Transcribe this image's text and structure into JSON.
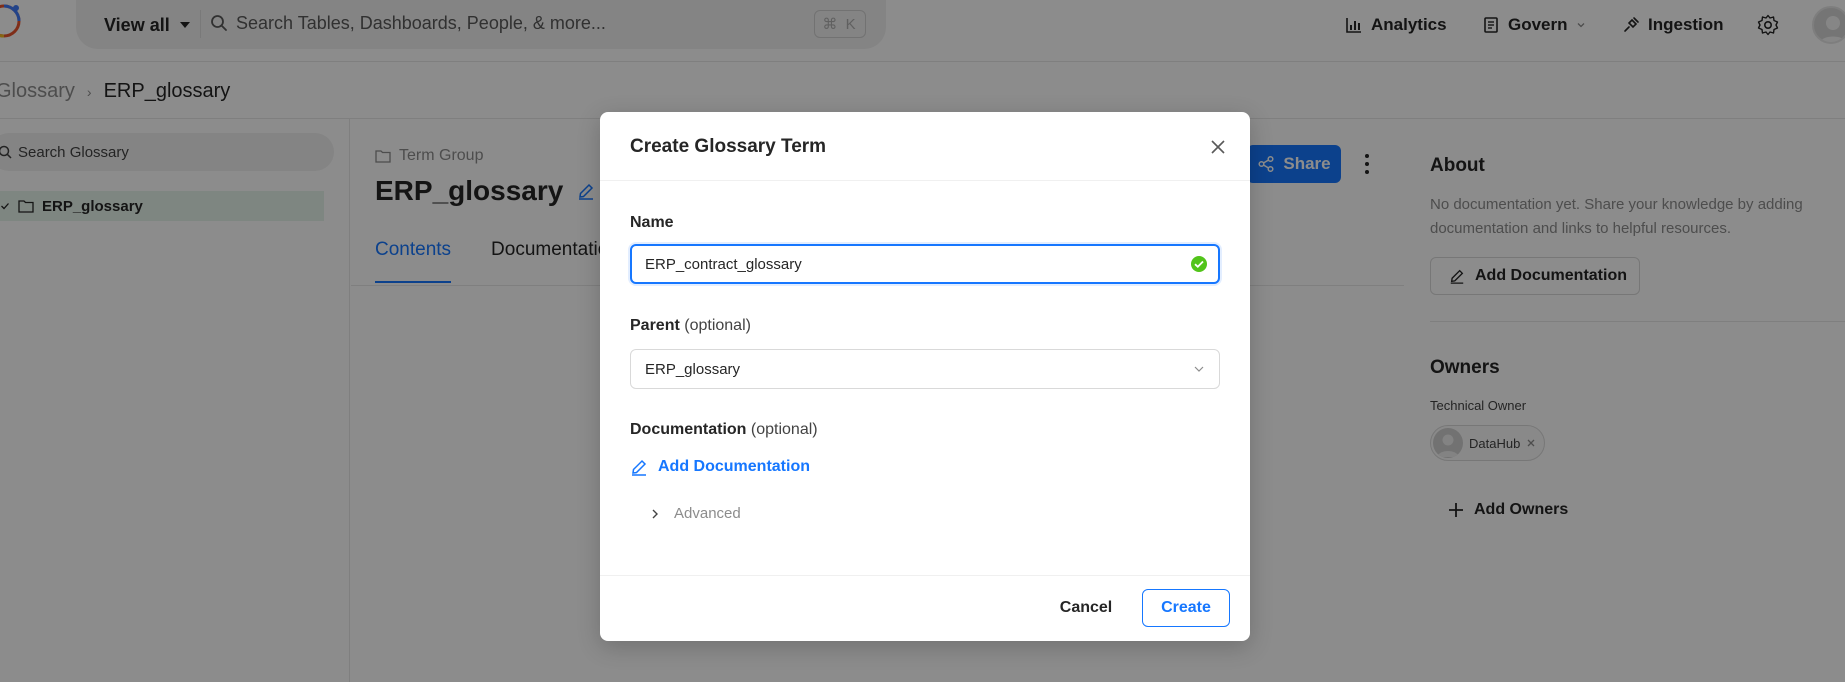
{
  "topbar": {
    "view_all": "View all",
    "search_placeholder": "Search Tables, Dashboards, People, & more...",
    "shortcut": "⌘ K",
    "nav": {
      "analytics": "Analytics",
      "govern": "Govern",
      "ingestion": "Ingestion"
    }
  },
  "breadcrumb": {
    "parent": "Glossary",
    "current": "ERP_glossary"
  },
  "sidebar": {
    "search_placeholder": "Search Glossary",
    "items": [
      {
        "label": "ERP_glossary",
        "selected": true
      }
    ]
  },
  "entity": {
    "type": "Term Group",
    "name": "ERP_glossary",
    "share": "Share",
    "tabs": [
      {
        "label": "Contents",
        "active": true
      },
      {
        "label": "Documentation",
        "active": false
      }
    ]
  },
  "right_panel": {
    "about_title": "About",
    "about_text": "No documentation yet. Share your knowledge by adding documentation and links to helpful resources.",
    "add_documentation": "Add Documentation",
    "owners_title": "Owners",
    "owner_type": "Technical Owner",
    "owner_name": "DataHub",
    "add_owners": "Add Owners"
  },
  "modal": {
    "title": "Create Glossary Term",
    "name_label": "Name",
    "name_value": "ERP_contract_glossary",
    "parent_label": "Parent",
    "parent_optional": "(optional)",
    "parent_value": "ERP_glossary",
    "doc_label": "Documentation",
    "doc_optional": "(optional)",
    "add_documentation": "Add Documentation",
    "advanced": "Advanced",
    "cancel": "Cancel",
    "create": "Create"
  },
  "colors": {
    "primary": "#1677ff",
    "success": "#52c41a",
    "overlay": "rgba(0,0,0,0.45)",
    "tree_selected_bg": "#e6f4ec"
  }
}
